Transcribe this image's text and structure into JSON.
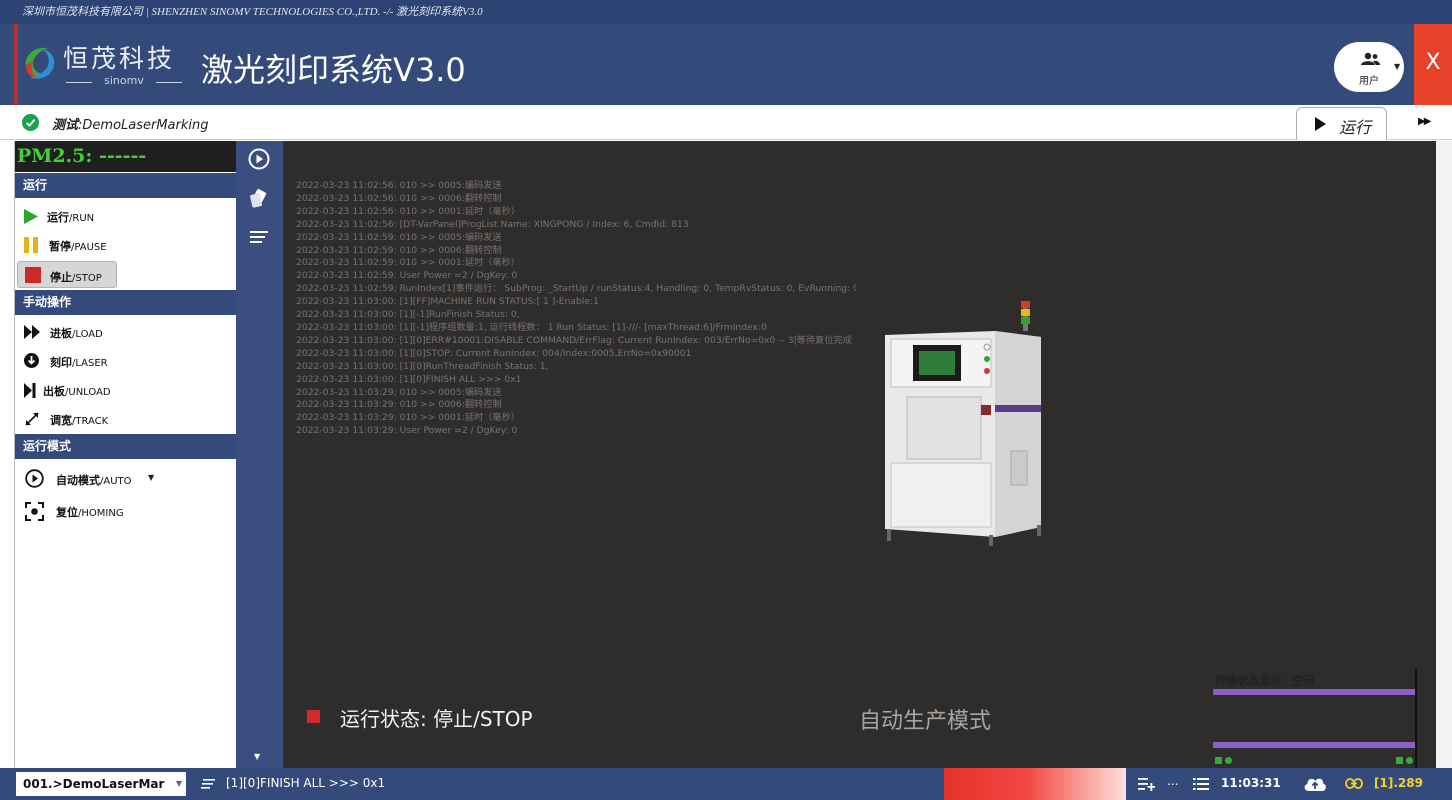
{
  "window": {
    "titlebar_text": "深圳市恒茂科技有限公司 | SHENZHEN SINOMV TECHNOLOGIES CO.,LTD. -/- 激光刻印系统V3.0"
  },
  "header": {
    "logo_cn": "恒茂科技",
    "logo_en": "sinomv",
    "app_title": "激光刻印系统V3.0",
    "user_label": "用户",
    "close_label": "X"
  },
  "subbar": {
    "test_prefix": "测试",
    "test_name": ":DemoLaserMarking",
    "run_tab_label": "运行"
  },
  "left_panel": {
    "pm25": "PM2.5: ------",
    "sections": {
      "run": "运行",
      "manual": "手动操作",
      "mode": "运行模式"
    },
    "run_items": [
      {
        "cn": "运行",
        "en": "/RUN"
      },
      {
        "cn": "暂停",
        "en": "/PAUSE"
      },
      {
        "cn": "停止",
        "en": "/STOP"
      }
    ],
    "manual_items": [
      {
        "cn": "进板",
        "en": "/LOAD"
      },
      {
        "cn": "刻印",
        "en": "/LASER"
      },
      {
        "cn": "出板",
        "en": "/UNLOAD"
      },
      {
        "cn": "调宽",
        "en": "/TRACK"
      }
    ],
    "mode_items": [
      {
        "cn": "自动模式",
        "en": "/AUTO"
      },
      {
        "cn": "复位",
        "en": "/HOMING"
      }
    ]
  },
  "log_lines": [
    "2022-03-23 11:02:56: 010 >> 0005:编码发送",
    "2022-03-23 11:02:56: 010 >> 0006:翻转控制",
    "2022-03-23 11:02:56: 010 >> 0001:延时（毫秒）",
    "2022-03-23 11:02:56: [DT-VarPanel]ProgList Name: XINGPONG / Index: 6, CmdId: 813",
    "2022-03-23 11:02:59: 010 >> 0005:编码发送",
    "2022-03-23 11:02:59: 010 >> 0006:翻转控制",
    "2022-03-23 11:02:59: 010 >> 0001:延时（毫秒）",
    "2022-03-23 11:02:59: User Power =2 / DgKey: 0",
    "2022-03-23 11:02:59: RunIndex[1]事件运行： SubProg: _StartUp / runStatus:4, Handling: 0, TempRvStatus: 0, EvRunning: 0",
    "2022-03-23 11:03:00: [1][FF]MACHINE RUN STATUS:[ 1 ]-Enable:1",
    "2022-03-23 11:03:00: [1][-1]RunFinish Status: 0,",
    "2022-03-23 11:03:00: [1][-1]程序组数量:1, 运行线程数： 1 Run Status: [1]-///- [maxThread:6]/FrmIndex:0",
    "2022-03-23 11:03:00: [1][0]ERR#10001:DISABLE COMMAND/ErrFlag: Current RunIndex: 003/ErrNo=0x0 -- 3|等待复位完成",
    "2022-03-23 11:03:00: [1][0]STOP: Current RunIndex: 004/Index:0005,ErrNo=0x90001",
    "2022-03-23 11:03:00: [1][0]RunThreadFinish Status: 1,",
    "2022-03-23 11:03:00: [1][0]FINISH ALL >>> 0x1",
    "2022-03-23 11:03:29: 010 >> 0005:编码发送",
    "2022-03-23 11:03:29: 010 >> 0006:翻转控制",
    "2022-03-23 11:03:29: 010 >> 0001:延时（毫秒）",
    "2022-03-23 11:03:29: User Power =2 / DgKey: 0"
  ],
  "main": {
    "status_text": "运行状态: 停止/STOP",
    "mode_text": "自动生产模式",
    "transfer_caption": "传输状态显示：空闲"
  },
  "bottom": {
    "recipe": "001.>DemoLaserMar",
    "message": "[1][0]FINISH ALL >>> 0x1",
    "tools_more": "...",
    "time": "11:03:31",
    "connection": "[1].289"
  },
  "colors": {
    "header_bg": "#344a7a",
    "main_bg": "#2f2d2c",
    "pm_text": "#44cf36",
    "stop_red": "#cf2b2b",
    "close_red": "#e8412a",
    "transfer_line": "#8c5fc6",
    "conn_yellow": "#f4d32c"
  },
  "icons": {
    "logo": "sinomv-logo-icon",
    "user": "users-icon",
    "check": "check-circle-icon",
    "run": "play-icon",
    "pause": "pause-icon",
    "stop": "stop-icon",
    "load": "fast-forward-icon",
    "laser": "arrow-down-circle-icon",
    "unload": "skip-icon",
    "track": "expand-icon",
    "auto": "play-circle-icon",
    "homing": "target-icon",
    "cloud": "cloud-upload-icon",
    "link": "link-icon"
  }
}
